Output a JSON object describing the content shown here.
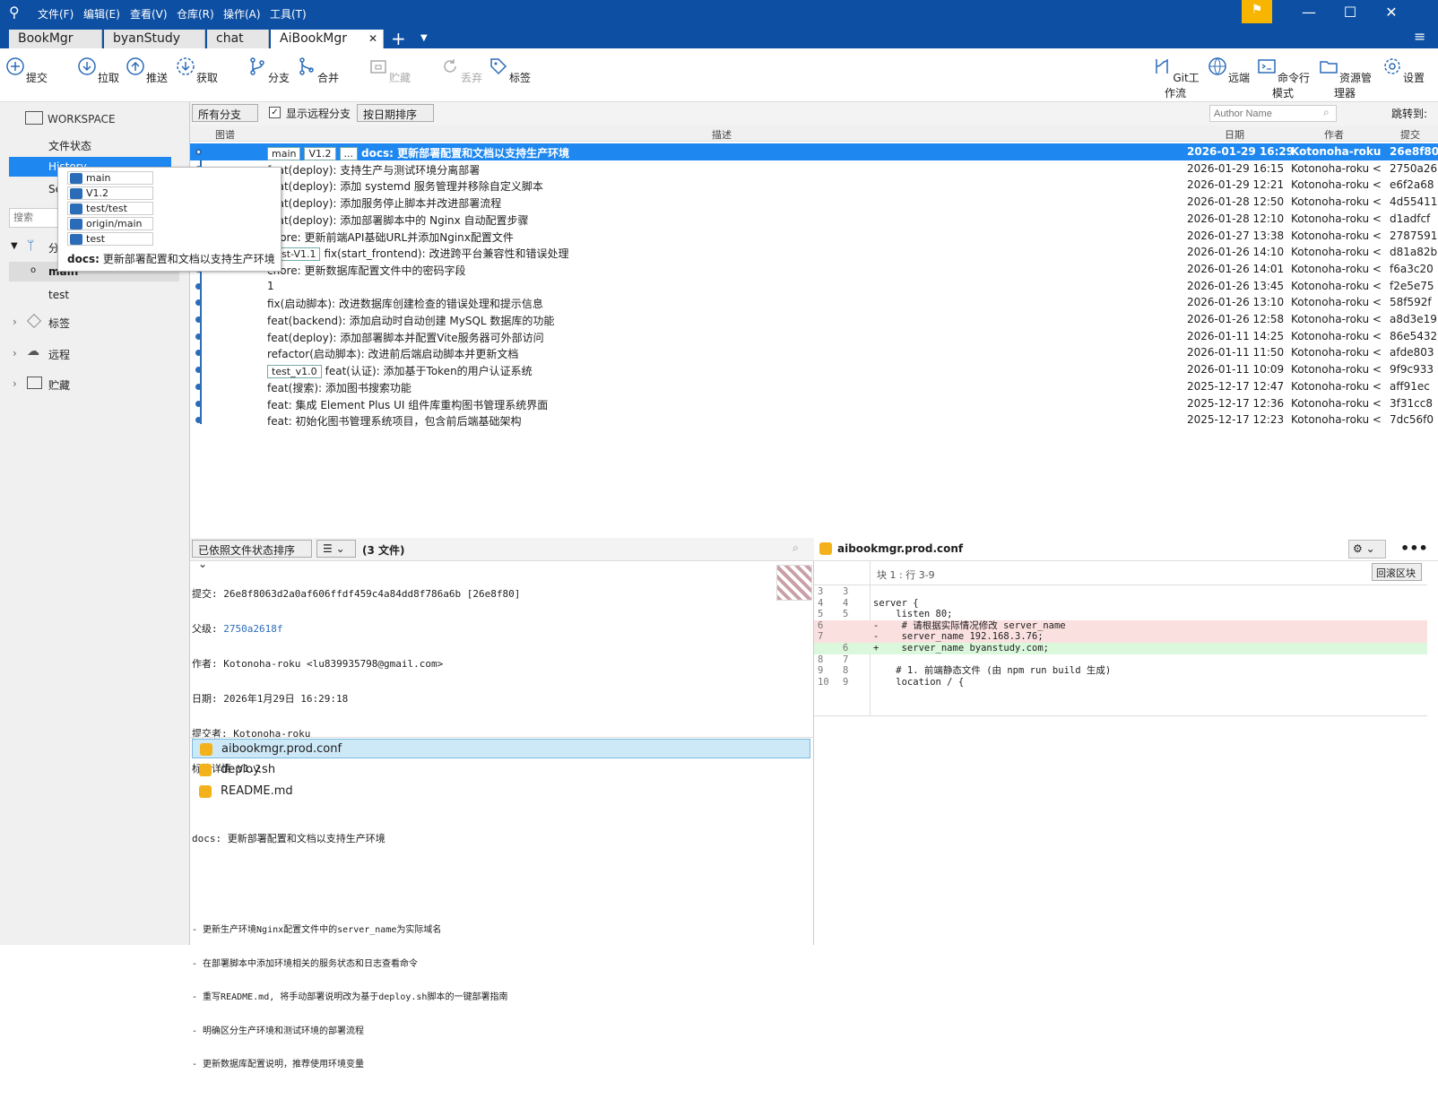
{
  "menu": [
    "文件(F)",
    "编辑(E)",
    "查看(V)",
    "仓库(R)",
    "操作(A)",
    "工具(T)"
  ],
  "tabs": [
    "BookMgr",
    "byanStudy",
    "chat",
    "AiBookMgr"
  ],
  "toolbar": {
    "commit": "提交",
    "pull": "拉取",
    "push": "推送",
    "fetch": "获取",
    "branch": "分支",
    "merge": "合并",
    "stash": "贮藏",
    "discard": "丢弃",
    "tag": "标签",
    "gitflow": "Git工作流",
    "remote": "远端",
    "terminal": "命令行模式",
    "explorer": "资源管理器",
    "settings": "设置"
  },
  "sidebar": {
    "workspace": "WORKSPACE",
    "file_status": "文件状态",
    "history": "History",
    "search_item": "Search",
    "search_placeholder": "搜索",
    "branches_header": "分支",
    "branches": [
      "main",
      "test"
    ],
    "tags": "标签",
    "remotes": "远程",
    "stashes": "贮藏"
  },
  "filterbar": {
    "branch_filter": "所有分支",
    "show_remote": "显示远程分支",
    "sort": "按日期排序",
    "author_placeholder": "Author Name",
    "jump": "跳转到:"
  },
  "columns": {
    "graph": "图谱",
    "desc": "描述",
    "date": "日期",
    "author": "作者",
    "commit": "提交"
  },
  "commits": [
    {
      "tags": [
        "main",
        "V1.2",
        "..."
      ],
      "msg": "docs: 更新部署配置和文档以支持生产环境",
      "date": "2026-01-29 16:29",
      "author": "Kotonoha-roku",
      "hash": "26e8f80"
    },
    {
      "tags": [],
      "msg": "feat(deploy): 支持生产与测试环境分离部署",
      "date": "2026-01-29 16:15",
      "author": "Kotonoha-roku <",
      "hash": "2750a26"
    },
    {
      "tags": [],
      "msg": "feat(deploy): 添加 systemd 服务管理并移除自定义脚本",
      "date": "2026-01-29 12:21",
      "author": "Kotonoha-roku <",
      "hash": "e6f2a68"
    },
    {
      "tags": [],
      "msg": "feat(deploy): 添加服务停止脚本并改进部署流程",
      "date": "2026-01-28 12:50",
      "author": "Kotonoha-roku <",
      "hash": "4d55411"
    },
    {
      "tags": [],
      "msg": "feat(deploy): 添加部署脚本中的 Nginx 自动配置步骤",
      "date": "2026-01-28 12:10",
      "author": "Kotonoha-roku <",
      "hash": "d1adfcf"
    },
    {
      "tags": [],
      "msg": "chore: 更新前端API基础URL并添加Nginx配置文件",
      "date": "2026-01-27 13:38",
      "author": "Kotonoha-roku <",
      "hash": "2787591"
    },
    {
      "tags": [
        "test-V1.1"
      ],
      "msg": "fix(start_frontend): 改进跨平台兼容性和错误处理",
      "date": "2026-01-26 14:10",
      "author": "Kotonoha-roku <",
      "hash": "d81a82b"
    },
    {
      "tags": [],
      "msg": "chore: 更新数据库配置文件中的密码字段",
      "date": "2026-01-26 14:01",
      "author": "Kotonoha-roku <",
      "hash": "f6a3c20"
    },
    {
      "tags": [],
      "msg": "1",
      "date": "2026-01-26 13:45",
      "author": "Kotonoha-roku <",
      "hash": "f2e5e75"
    },
    {
      "tags": [],
      "msg": "fix(启动脚本): 改进数据库创建检查的错误处理和提示信息",
      "date": "2026-01-26 13:10",
      "author": "Kotonoha-roku <",
      "hash": "58f592f"
    },
    {
      "tags": [],
      "msg": "feat(backend): 添加启动时自动创建 MySQL 数据库的功能",
      "date": "2026-01-26 12:58",
      "author": "Kotonoha-roku <",
      "hash": "a8d3e19"
    },
    {
      "tags": [],
      "msg": "feat(deploy): 添加部署脚本并配置Vite服务器可外部访问",
      "date": "2026-01-11 14:25",
      "author": "Kotonoha-roku <",
      "hash": "86e5432"
    },
    {
      "tags": [],
      "msg": "refactor(启动脚本): 改进前后端启动脚本并更新文档",
      "date": "2026-01-11 11:50",
      "author": "Kotonoha-roku <",
      "hash": "afde803"
    },
    {
      "tags": [
        "test_v1.0"
      ],
      "msg": "feat(认证): 添加基于Token的用户认证系统",
      "date": "2026-01-11 10:09",
      "author": "Kotonoha-roku <",
      "hash": "9f9c933"
    },
    {
      "tags": [],
      "msg": "feat(搜索): 添加图书搜索功能",
      "date": "2025-12-17 12:47",
      "author": "Kotonoha-roku <",
      "hash": "aff91ec"
    },
    {
      "tags": [],
      "msg": "feat: 集成 Element Plus UI 组件库重构图书管理系统界面",
      "date": "2025-12-17 12:36",
      "author": "Kotonoha-roku <",
      "hash": "3f31cc8"
    },
    {
      "tags": [],
      "msg": "feat: 初始化图书管理系统项目，包含前后端基础架构",
      "date": "2025-12-17 12:23",
      "author": "Kotonoha-roku <",
      "hash": "7dc56f0"
    }
  ],
  "popup": {
    "refs": [
      "main",
      "V1.2",
      "test/test",
      "origin/main",
      "test"
    ],
    "label": "docs:",
    "msg": "更新部署配置和文档以支持生产环境"
  },
  "lower": {
    "sort": "已依照文件状态排序",
    "list_mode": "☰",
    "file_count": "(3 文件)"
  },
  "detail": {
    "commit_line": "提交: 26e8f8063d2a0af606ffdf459c4a84dd8f786a6b [26e8f80]",
    "parent_label": "父级:",
    "parent": "2750a2618f",
    "author": "作者: Kotonoha-roku <lu839935798@gmail.com>",
    "date": "日期: 2026年1月29日 16:29:18",
    "committer": "提交者: Kotonoha-roku",
    "tagline": "标签详情 V1.2",
    "title": "docs: 更新部署配置和文档以支持生产环境",
    "bullets": [
      "- 更新生产环境Nginx配置文件中的server_name为实际域名",
      "- 在部署脚本中添加环境相关的服务状态和日志查看命令",
      "- 重写README.md, 将手动部署说明改为基于deploy.sh脚本的一键部署指南",
      "- 明确区分生产环境和测试环境的部署流程",
      "- 更新数据库配置说明，推荐使用环境变量"
    ]
  },
  "files": [
    "aibookmgr.prod.conf",
    "deploy.sh",
    "README.md"
  ],
  "diff": {
    "file": "aibookmgr.prod.conf",
    "hunk": "块 1 : 行 3-9",
    "rollback": "回滚区块",
    "lines": [
      {
        "o": "3",
        "n": "3",
        "t": "",
        "k": ""
      },
      {
        "o": "4",
        "n": "4",
        "t": "server {",
        "k": ""
      },
      {
        "o": "5",
        "n": "5",
        "t": "    listen 80;",
        "k": ""
      },
      {
        "o": "6",
        "n": "",
        "t": "-    # 请根据实际情况修改 server_name",
        "k": "del"
      },
      {
        "o": "7",
        "n": "",
        "t": "-    server_name 192.168.3.76;",
        "k": "del"
      },
      {
        "o": "",
        "n": "6",
        "t": "+    server_name byanstudy.com;",
        "k": "add"
      },
      {
        "o": "8",
        "n": "7",
        "t": "",
        "k": ""
      },
      {
        "o": "9",
        "n": "8",
        "t": "    # 1. 前端静态文件 (由 npm run build 生成)",
        "k": ""
      },
      {
        "o": "10",
        "n": "9",
        "t": "    location / {",
        "k": ""
      }
    ]
  }
}
